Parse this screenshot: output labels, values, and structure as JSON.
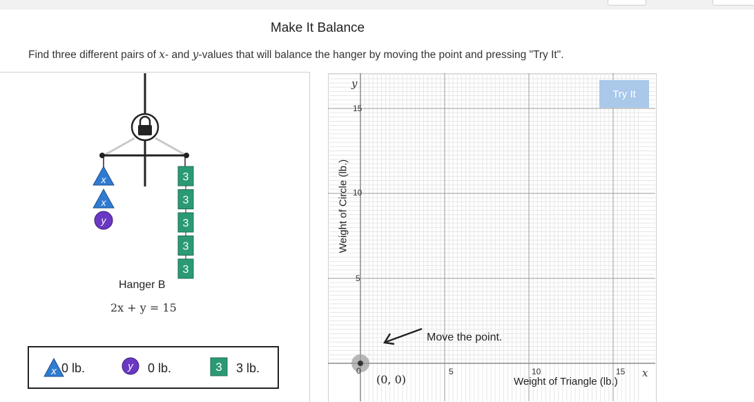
{
  "page": {
    "title": "Make It Balance",
    "instruction_pre": "Find three different pairs of ",
    "var_x": "x",
    "instruction_mid1": "- and ",
    "var_y": "y",
    "instruction_post": "-values that will balance the hanger by moving the point and pressing \"Try It\"."
  },
  "hanger": {
    "name": "Hanger B",
    "equation": "2x + y = 15",
    "left_shapes": [
      {
        "type": "triangle",
        "label": "x"
      },
      {
        "type": "triangle",
        "label": "x"
      },
      {
        "type": "circle",
        "label": "y"
      }
    ],
    "right_squares": [
      "3",
      "3",
      "3",
      "3",
      "3"
    ],
    "lock": "lock-icon"
  },
  "legend": {
    "triangle_symbol": "x",
    "triangle_weight": "0 lb.",
    "circle_symbol": "y",
    "circle_weight": "0 lb.",
    "square_symbol": "3",
    "square_weight": "3 lb."
  },
  "graph": {
    "try_it": "Try It",
    "y_axis_name": "y",
    "x_axis_name": "x",
    "y_label": "Weight of Circle (lb.)",
    "x_label": "Weight of Triangle (lb.)",
    "y_ticks": [
      "15",
      "10",
      "5"
    ],
    "x_ticks": [
      "5",
      "10",
      "15"
    ],
    "origin": "0",
    "hint": "Move the point.",
    "point_label": "(0, 0)",
    "point": {
      "x": 0,
      "y": 0
    },
    "x_range": [
      0,
      16.5
    ],
    "y_range": [
      0,
      17
    ]
  },
  "colors": {
    "triangle": "#2f7bd1",
    "circle": "#6a38c2",
    "square": "#2b9a74",
    "try_it_bg": "#a9c8ea"
  }
}
